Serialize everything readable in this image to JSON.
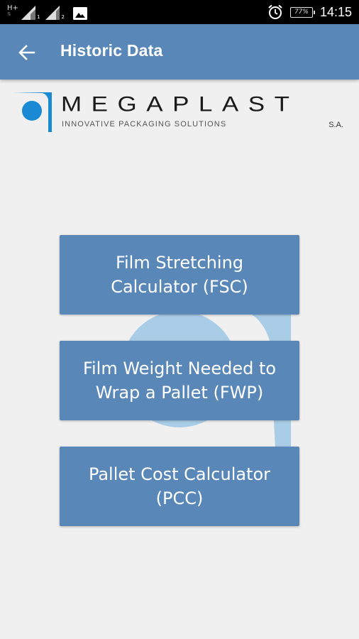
{
  "status_bar": {
    "network_type": "H+",
    "sim1_label": "1",
    "sim2_label": "2",
    "battery_percent": "77%",
    "time": "14:15",
    "icons": [
      "signal-icon",
      "signal-icon",
      "image-notification-icon",
      "alarm-icon",
      "battery-icon"
    ]
  },
  "app_bar": {
    "back_icon": "arrow-left-icon",
    "title": "Historic Data"
  },
  "logo": {
    "wordmark": "MEGAPLAST",
    "tagline": "INNOVATIVE PACKAGING SOLUTIONS",
    "suffix": "S.A."
  },
  "buttons": [
    {
      "id": "fsc",
      "label": "Film Stretching Calculator (FSC)"
    },
    {
      "id": "fwp",
      "label": "Film Weight Needed to Wrap a Pallet (FWP)"
    },
    {
      "id": "pcc",
      "label": "Pallet Cost Calculator (PCC)"
    }
  ],
  "colors": {
    "primary": "#5987b8",
    "background": "#f0f0f0",
    "logo_blue": "#1a8ad4",
    "watermark": "#a9cde6"
  }
}
